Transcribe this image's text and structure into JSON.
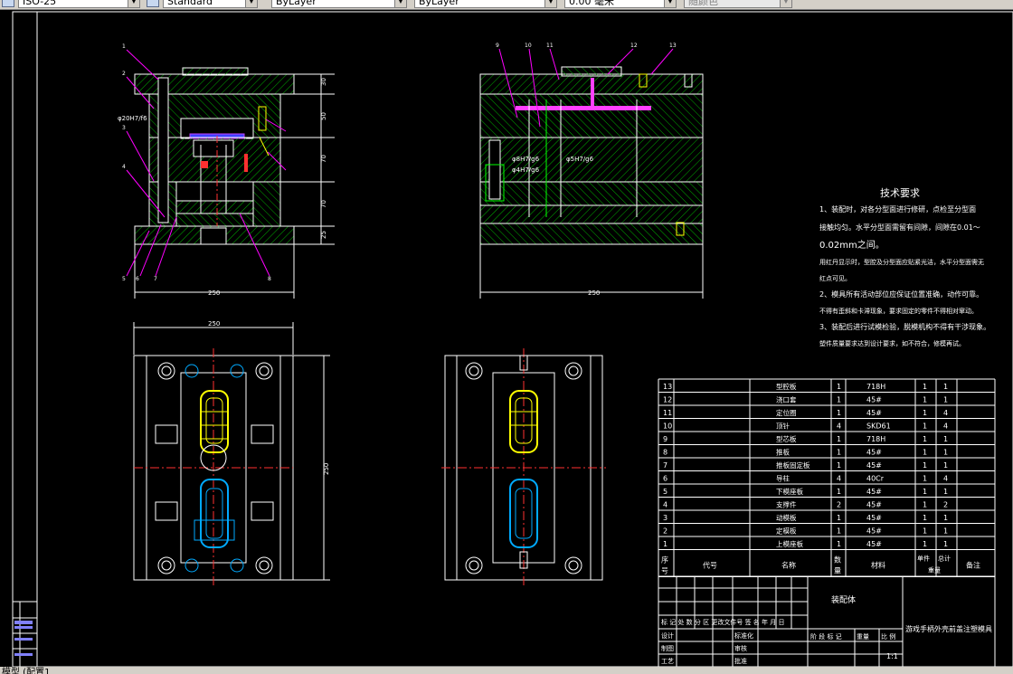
{
  "toolbar": {
    "dimstyle": "ISO-25",
    "tablestyle": "Standard",
    "layer": "ByLayer",
    "linetype": "ByLayer",
    "lineweight": "0.00 毫米",
    "plotstyle": "随颜色"
  },
  "status": {
    "tab": "模型 (配置1"
  },
  "tech": {
    "title": "技术要求",
    "line1": "1、装配时，对各分型面进行修研，点检至分型面",
    "line2": "接触均匀。水平分型面需留有间隙，间隙在0.01～",
    "line3": "0.02mm之间。",
    "line4": "用红丹显示时，型腔及分型面应贴紧光洁，水平分型面需无",
    "line5": "红点可见。",
    "line6": "2、模具所有活动部位应保证位置准确，动作可靠。",
    "line7": "不得有歪斜和卡滞现象，要求固定的零件不得相对窜动。",
    "line8": "3、装配后进行试模检验，脱模机构不得有干涉现象。",
    "line9": "塑件质量要求达到设计要求，如不符合，修模再试。"
  },
  "bom": [
    {
      "no": "13",
      "name": "型腔板",
      "qty": "1",
      "mat": "718H",
      "a": "1",
      "b": "1"
    },
    {
      "no": "12",
      "name": "浇口套",
      "qty": "1",
      "mat": "45#",
      "a": "1",
      "b": "1"
    },
    {
      "no": "11",
      "name": "定位圈",
      "qty": "1",
      "mat": "45#",
      "a": "1",
      "b": "4"
    },
    {
      "no": "10",
      "name": "顶针",
      "qty": "4",
      "mat": "SKD61",
      "a": "1",
      "b": "4"
    },
    {
      "no": "9",
      "name": "型芯板",
      "qty": "1",
      "mat": "718H",
      "a": "1",
      "b": "1"
    },
    {
      "no": "8",
      "name": "推板",
      "qty": "1",
      "mat": "45#",
      "a": "1",
      "b": "1"
    },
    {
      "no": "7",
      "name": "推板固定板",
      "qty": "1",
      "mat": "45#",
      "a": "1",
      "b": "1"
    },
    {
      "no": "6",
      "name": "导柱",
      "qty": "4",
      "mat": "40Cr",
      "a": "1",
      "b": "4"
    },
    {
      "no": "5",
      "name": "下模座板",
      "qty": "1",
      "mat": "45#",
      "a": "1",
      "b": "1"
    },
    {
      "no": "4",
      "name": "支撑件",
      "qty": "2",
      "mat": "45#",
      "a": "1",
      "b": "2"
    },
    {
      "no": "3",
      "name": "动模板",
      "qty": "1",
      "mat": "45#",
      "a": "1",
      "b": "1"
    },
    {
      "no": "2",
      "name": "定模板",
      "qty": "1",
      "mat": "45#",
      "a": "1",
      "b": "1"
    },
    {
      "no": "1",
      "name": "上模座板",
      "qty": "1",
      "mat": "45#",
      "a": "1",
      "b": "1"
    }
  ],
  "bom_header": {
    "no": "序号",
    "code": "代号",
    "name": "名称",
    "qty": "数量",
    "mat": "材料",
    "unit": "单件",
    "total": "总计",
    "weight": "重量",
    "note": "备注"
  },
  "title_block": {
    "drawing": "装配体",
    "part": "游戏手柄外壳前盖注塑模具",
    "row1": "标 记 处 数 分 区 更改文件号 签 名 年 月 日",
    "design": "设计",
    "std": "标准化",
    "drawn": "制图",
    "review": "审核",
    "craft": "工艺",
    "approve": "批准",
    "stage": "阶 段 标 记",
    "weight": "重量",
    "ratio": "比 例",
    "scale": "1:1"
  },
  "dims": {
    "w1": "250",
    "w2": "250",
    "w3": "250",
    "h1": "250",
    "fit1": "φ20H7/f6",
    "fit2": "φ8H7/g6",
    "fit3": "φ5H7/g6",
    "fit4": "φ4H7/g6",
    "v1": "30",
    "v2": "50",
    "v3": "70",
    "v4": "70",
    "v5": "25"
  },
  "balloons": {
    "b1": "1",
    "b2": "2",
    "b3": "3",
    "b4": "4",
    "b5": "5",
    "b6": "6",
    "b7": "7",
    "b8": "8",
    "b9": "9",
    "b10": "10",
    "b11": "11",
    "b12": "12",
    "b13": "13"
  },
  "colors": {
    "bg": "#000000",
    "line": "#ffffff",
    "hatch": "#00c000",
    "dim": "#ff00ff",
    "center": "#ff3030",
    "yellow": "#ffff00",
    "cyan": "#00aaff",
    "green": "#00ff00"
  }
}
